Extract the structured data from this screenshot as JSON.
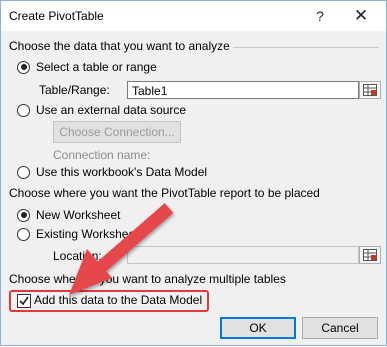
{
  "window": {
    "title": "Create PivotTable",
    "help_glyph": "?",
    "close_glyph": "✕"
  },
  "section_analyze": {
    "title": "Choose the data that you want to analyze",
    "select_table_label": "Select a table or range",
    "table_range_label": "Table/Range:",
    "table_range_value": "Table1",
    "external_source_label": "Use an external data source",
    "choose_connection_label": "Choose Connection...",
    "connection_name_label": "Connection name:",
    "data_model_label": "Use this workbook's Data Model",
    "selected": "select_table"
  },
  "section_place": {
    "title": "Choose where you want the PivotTable report to be placed",
    "new_worksheet_label": "New Worksheet",
    "existing_worksheet_label": "Existing Worksheet",
    "location_label": "Location:",
    "location_value": "",
    "selected": "new_worksheet"
  },
  "section_multiple": {
    "title": "Choose whether you want to analyze multiple tables",
    "add_to_model_label": "Add this data to the Data Model",
    "add_to_model_checked": true
  },
  "buttons": {
    "ok_label": "OK",
    "cancel_label": "Cancel"
  },
  "annotation": {
    "arrow_color": "#e0393e"
  }
}
